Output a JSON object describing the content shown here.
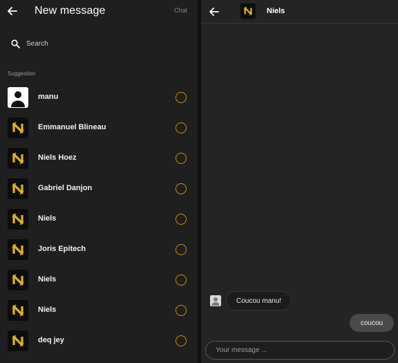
{
  "left_panel": {
    "title": "New message",
    "chat_link": "Chat",
    "search_placeholder": "Search",
    "section_label": "Suggestion",
    "contacts": [
      {
        "name": "manu",
        "avatar": "default-user"
      },
      {
        "name": "Emmanuel Blineau",
        "avatar": "logo"
      },
      {
        "name": "Niels Hoez",
        "avatar": "logo"
      },
      {
        "name": "Gabriel Danjon",
        "avatar": "logo"
      },
      {
        "name": "Niels",
        "avatar": "logo"
      },
      {
        "name": "Joris Epitech",
        "avatar": "logo"
      },
      {
        "name": "Niels",
        "avatar": "logo"
      },
      {
        "name": "Niels",
        "avatar": "logo"
      },
      {
        "name": "deq jey",
        "avatar": "logo"
      }
    ]
  },
  "right_panel": {
    "contact_name": "Niels",
    "messages": [
      {
        "direction": "incoming",
        "text": "Coucou manu!"
      },
      {
        "direction": "outgoing",
        "text": "coucou"
      }
    ],
    "composer_placeholder": "Your message ..."
  },
  "colors": {
    "accent_ring": "#c9920c",
    "panel_bg": "#1f1f1f",
    "logo_gold": "#e0b21a"
  }
}
